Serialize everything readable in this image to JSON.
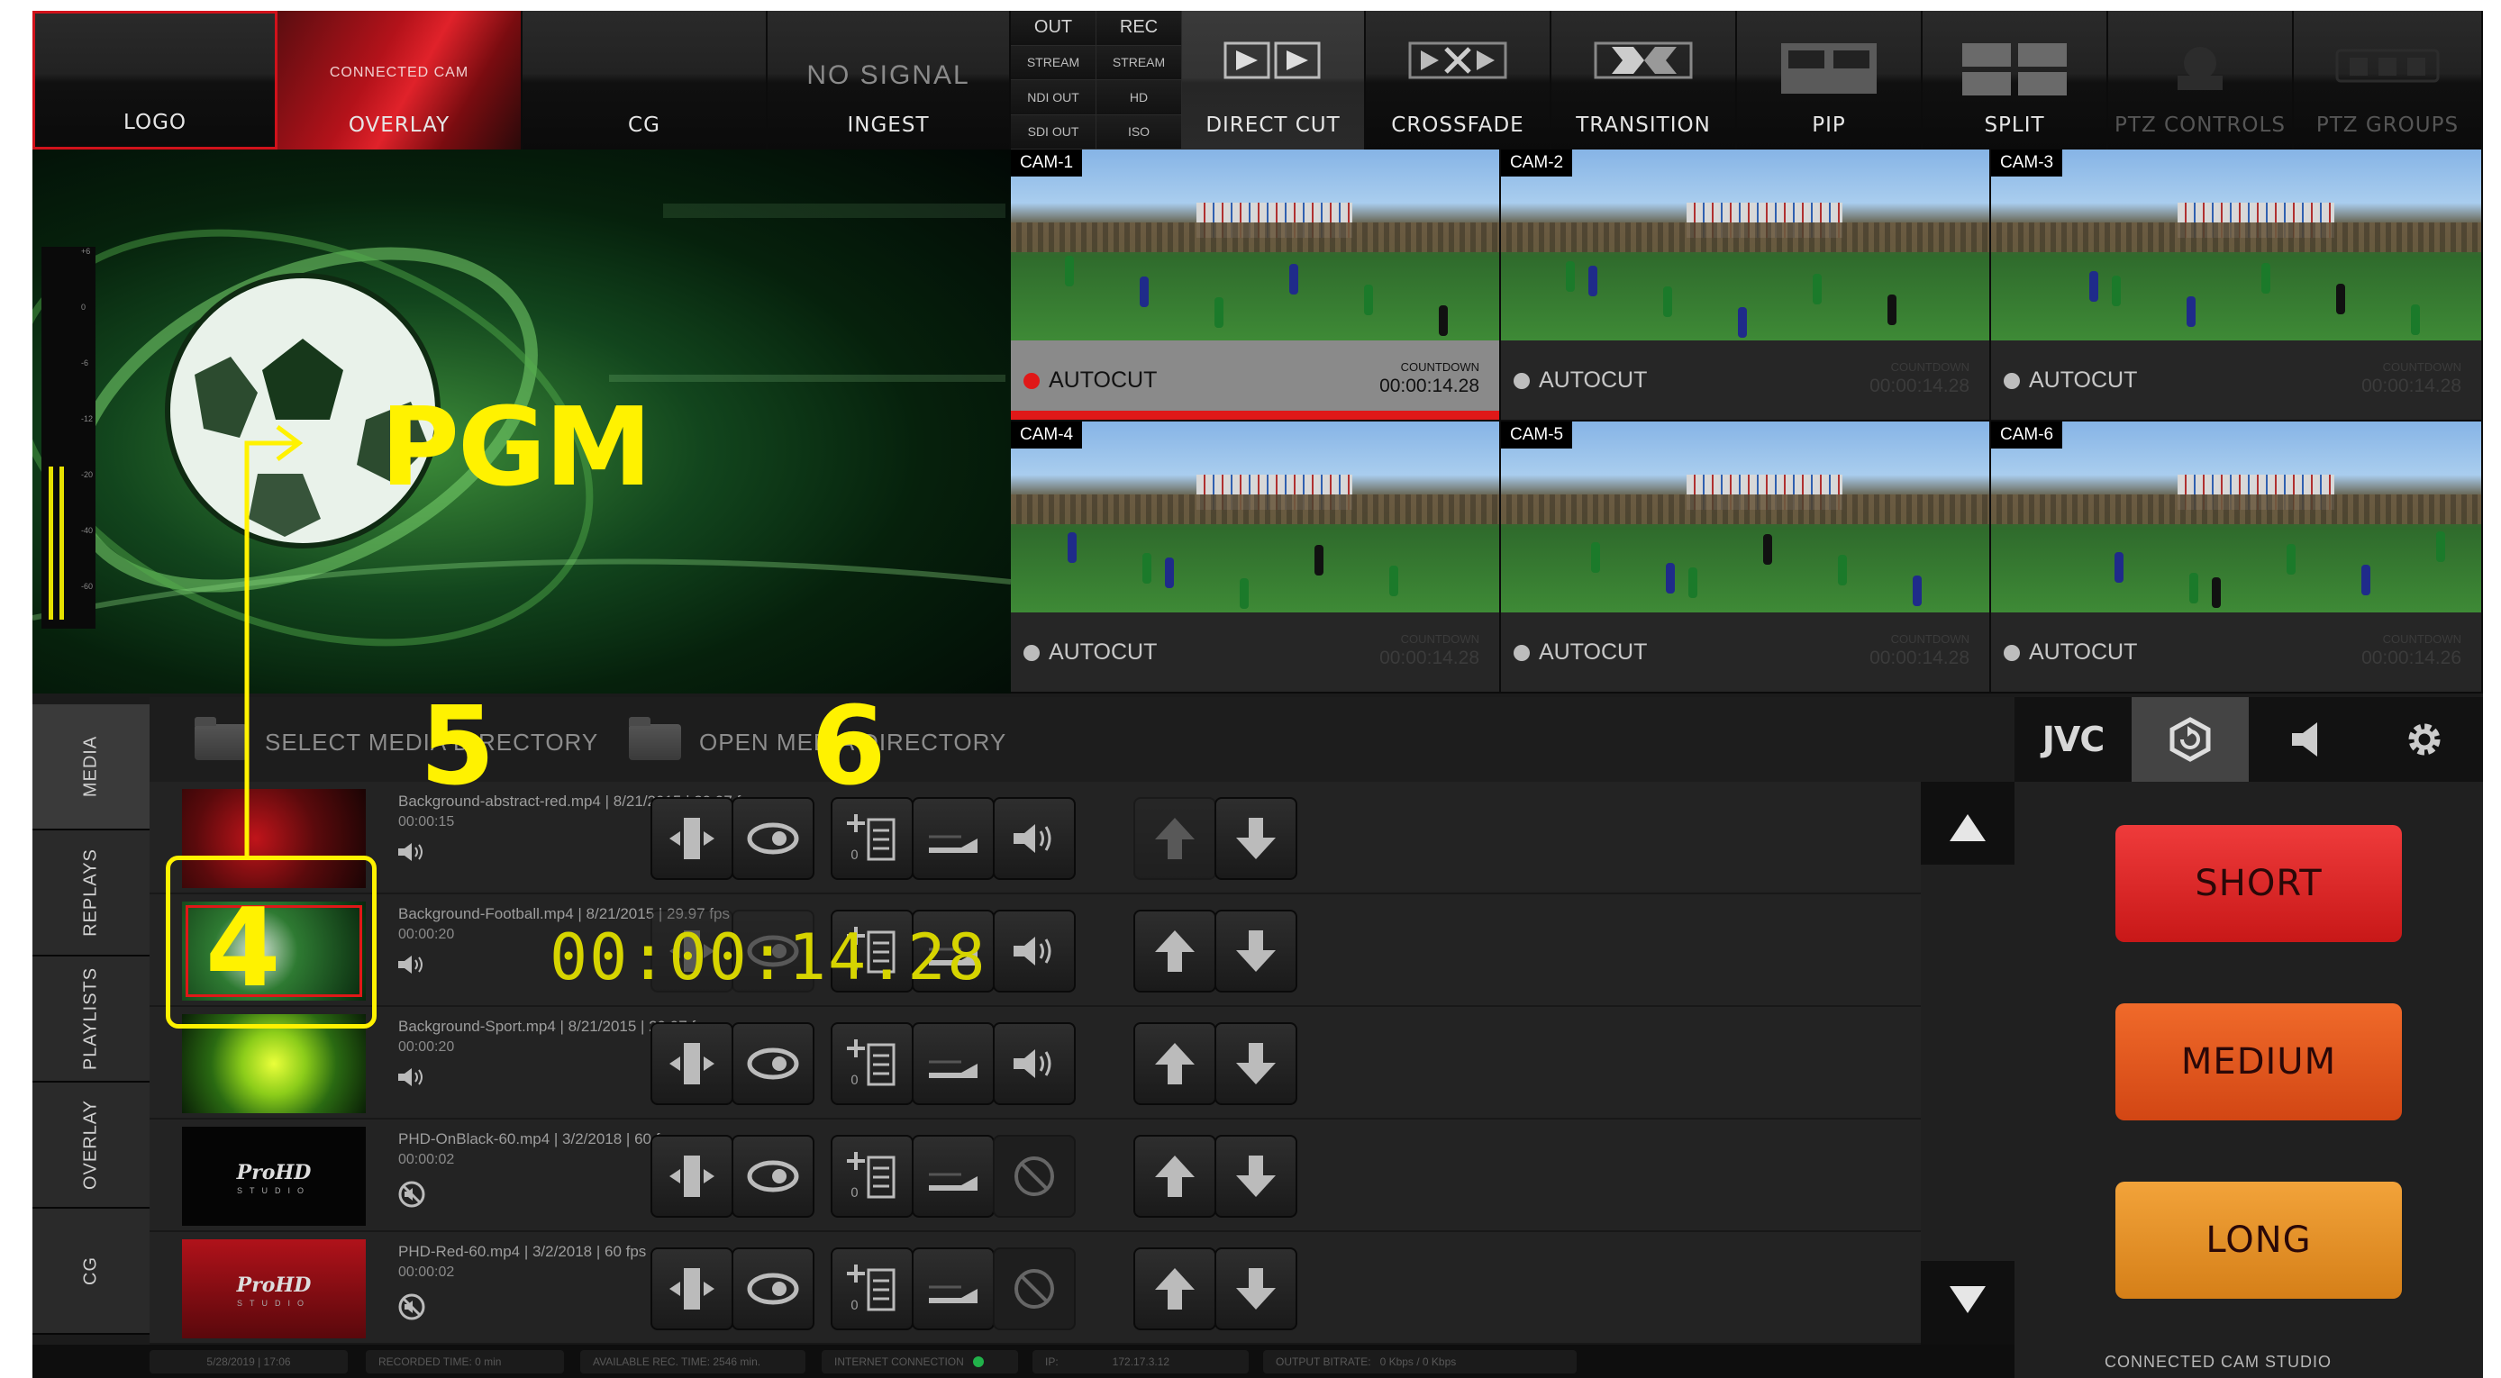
{
  "topbar": {
    "buttons": [
      {
        "label": "LOGO"
      },
      {
        "label": "OVERLAY",
        "preview_text": "CONNECTED CAM"
      },
      {
        "label": "CG"
      },
      {
        "label": "INGEST",
        "preview_text": "NO SIGNAL"
      },
      {
        "label": "DIRECT CUT"
      },
      {
        "label": "CROSSFADE"
      },
      {
        "label": "TRANSITION"
      },
      {
        "label": "PIP"
      },
      {
        "label": "SPLIT"
      },
      {
        "label": "PTZ CONTROLS"
      },
      {
        "label": "PTZ GROUPS"
      }
    ],
    "status_grid": {
      "headers": [
        "OUT",
        "REC"
      ],
      "cells": [
        "STREAM",
        "STREAM",
        "NDI OUT",
        "HD",
        "SDI OUT",
        "ISO"
      ]
    }
  },
  "pgm": {
    "label": "PGM",
    "vu_ticks": [
      "+6",
      "0",
      "-6",
      "-12",
      "-20",
      "-40",
      "-60"
    ]
  },
  "cameras": [
    {
      "name": "CAM-1",
      "mode": "AUTOCUT",
      "countdown_label": "COUNTDOWN",
      "countdown": "00:00:14.28",
      "live": true
    },
    {
      "name": "CAM-2",
      "mode": "AUTOCUT",
      "countdown_label": "COUNTDOWN",
      "countdown": "00:00:14.28",
      "live": false
    },
    {
      "name": "CAM-3",
      "mode": "AUTOCUT",
      "countdown_label": "COUNTDOWN",
      "countdown": "00:00:14.28",
      "live": false
    },
    {
      "name": "CAM-4",
      "mode": "AUTOCUT",
      "countdown_label": "COUNTDOWN",
      "countdown": "00:00:14.28",
      "live": false
    },
    {
      "name": "CAM-5",
      "mode": "AUTOCUT",
      "countdown_label": "COUNTDOWN",
      "countdown": "00:00:14.28",
      "live": false
    },
    {
      "name": "CAM-6",
      "mode": "AUTOCUT",
      "countdown_label": "COUNTDOWN",
      "countdown": "00:00:14.26",
      "live": false
    }
  ],
  "media": {
    "select_dir": "SELECT MEDIA DIRECTORY",
    "open_dir": "OPEN MEDIA DIRECTORY",
    "side_tabs": [
      "MEDIA",
      "REPLAYS",
      "PLAYLISTS",
      "OVERLAY",
      "CG"
    ],
    "timer": "00:00:14.28",
    "items": [
      {
        "title": "Background-abstract-red.mp4 | 8/21/2015 | 29.97 fps",
        "duration": "00:00:15",
        "audio": true,
        "clip_count": "0"
      },
      {
        "title": "Background-Football.mp4 | 8/21/2015 | 29.97 fps",
        "duration": "00:00:20",
        "audio": true,
        "clip_count": "0"
      },
      {
        "title": "Background-Sport.mp4 | 8/21/2015 | 29.97 fps",
        "duration": "00:00:20",
        "audio": true,
        "clip_count": "0"
      },
      {
        "title": "PHD-OnBlack-60.mp4 | 3/2/2018 | 60 fps",
        "duration": "00:00:02",
        "audio": false,
        "clip_count": "0"
      },
      {
        "title": "PHD-Red-60.mp4 | 3/2/2018 | 60 fps",
        "duration": "00:00:02",
        "audio": false,
        "clip_count": "0"
      }
    ]
  },
  "right_panel": {
    "tabs": [
      "JVC",
      "replay-icon",
      "speaker-icon",
      "gear-icon"
    ],
    "jvc_label": "JVC",
    "buttons": {
      "short": "SHORT",
      "medium": "MEDIUM",
      "long": "LONG"
    },
    "brand": "CONNECTED CAM STUDIO",
    "colors": {
      "short": "#e02828",
      "medium": "#e2571e",
      "long": "#e89028"
    }
  },
  "status_bar": {
    "date": "5/28/2019 | 17:06",
    "recorded_time": "RECORDED TIME: 0 min",
    "available_rec": "AVAILABLE REC. TIME: 2546 min.",
    "internet": "INTERNET CONNECTION",
    "ip_label": "IP:",
    "ip": "172.17.3.12",
    "bitrate_label": "OUTPUT BITRATE:",
    "bitrate": "0 Kbps / 0 Kbps"
  },
  "annotations": {
    "n4": "4",
    "n5": "5",
    "n6": "6",
    "accent": "#fff200"
  }
}
